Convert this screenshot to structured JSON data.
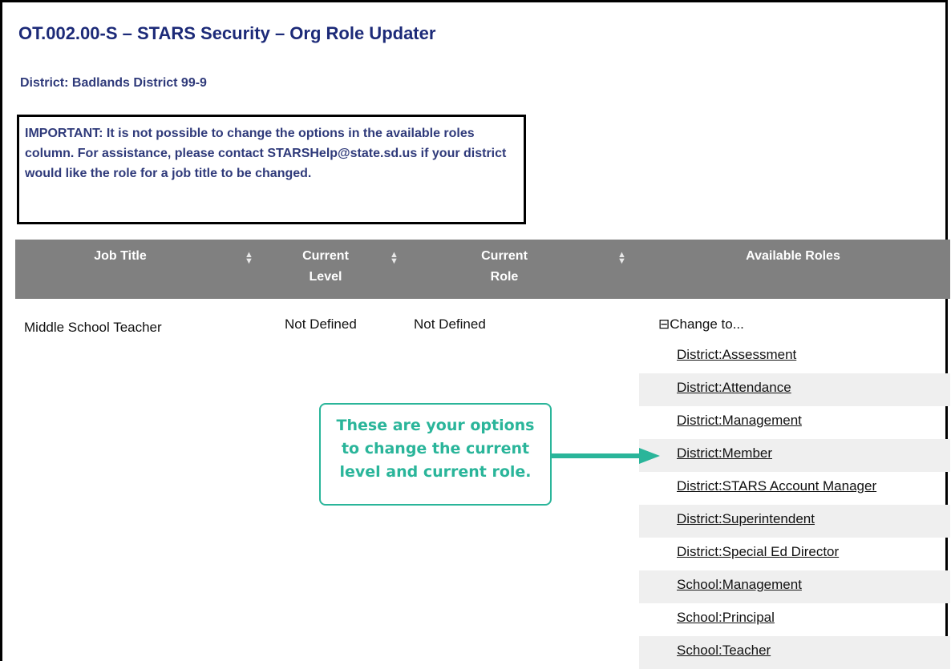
{
  "page": {
    "title": "OT.002.00-S – STARS Security – Org Role Updater",
    "district": "District: Badlands District 99-9",
    "notice": "IMPORTANT: It is not possible to change the options in the available roles column. For assistance, please contact STARSHelp@state.sd.us if your district would like the role for a job title to be changed."
  },
  "table": {
    "headers": {
      "job_title": "Job Title",
      "current_level_1": "Current",
      "current_level_2": "Level",
      "current_role_1": "Current",
      "current_role_2": "Role",
      "available_roles": "Available Roles"
    },
    "row": {
      "job_title": "Middle School Teacher",
      "current_level": "Not Defined",
      "current_role": "Not Defined",
      "change_to_label": "Change to...",
      "change_to_glyph": "⊟"
    },
    "available_roles": [
      "District:Assessment",
      "District:Attendance",
      "District:Management",
      "District:Member",
      "District:STARS Account Manager",
      "District:Superintendent",
      "District:Special Ed Director",
      "School:Management",
      "School:Principal",
      "School:Teacher"
    ]
  },
  "callout": {
    "line1": "These are your options",
    "line2": "to change the current",
    "line3": "level and current role.",
    "color": "#2ab59a"
  },
  "icons": {
    "sort": "sort-icon",
    "collapse": "collapse-icon",
    "arrow": "arrow-right-icon"
  },
  "colors": {
    "title": "#1c2a78",
    "header_bg": "#808080",
    "row_shade": "#efefef"
  }
}
